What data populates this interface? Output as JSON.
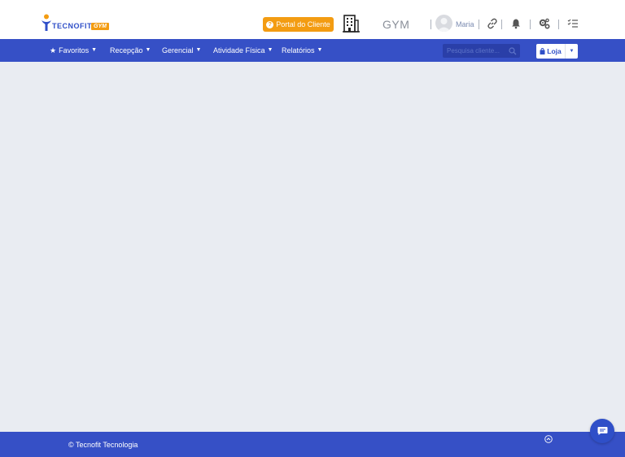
{
  "header": {
    "logo_word": "TECNOFIT",
    "logo_badge": "GYM",
    "portal_button_label": "Portal do Cliente",
    "unit_label": "GYM",
    "user_name": "Maria",
    "icons": [
      "building-icon",
      "link-icon",
      "bell-icon",
      "gears-icon",
      "checklist-icon"
    ]
  },
  "nav": {
    "items": [
      {
        "label": "Favoritos",
        "icon": "star-icon"
      },
      {
        "label": "Recepção"
      },
      {
        "label": "Gerencial"
      },
      {
        "label": "Atividade Física"
      },
      {
        "label": "Relatórios"
      }
    ],
    "search_placeholder": "Pesquisa cliente...",
    "store_button_label": "Loja"
  },
  "footer": {
    "copyright": "© Tecnofit Tecnologia"
  },
  "colors": {
    "brand_blue": "#3650c6",
    "accent_orange": "#f39c12",
    "page_bg": "#e9ecf2"
  }
}
